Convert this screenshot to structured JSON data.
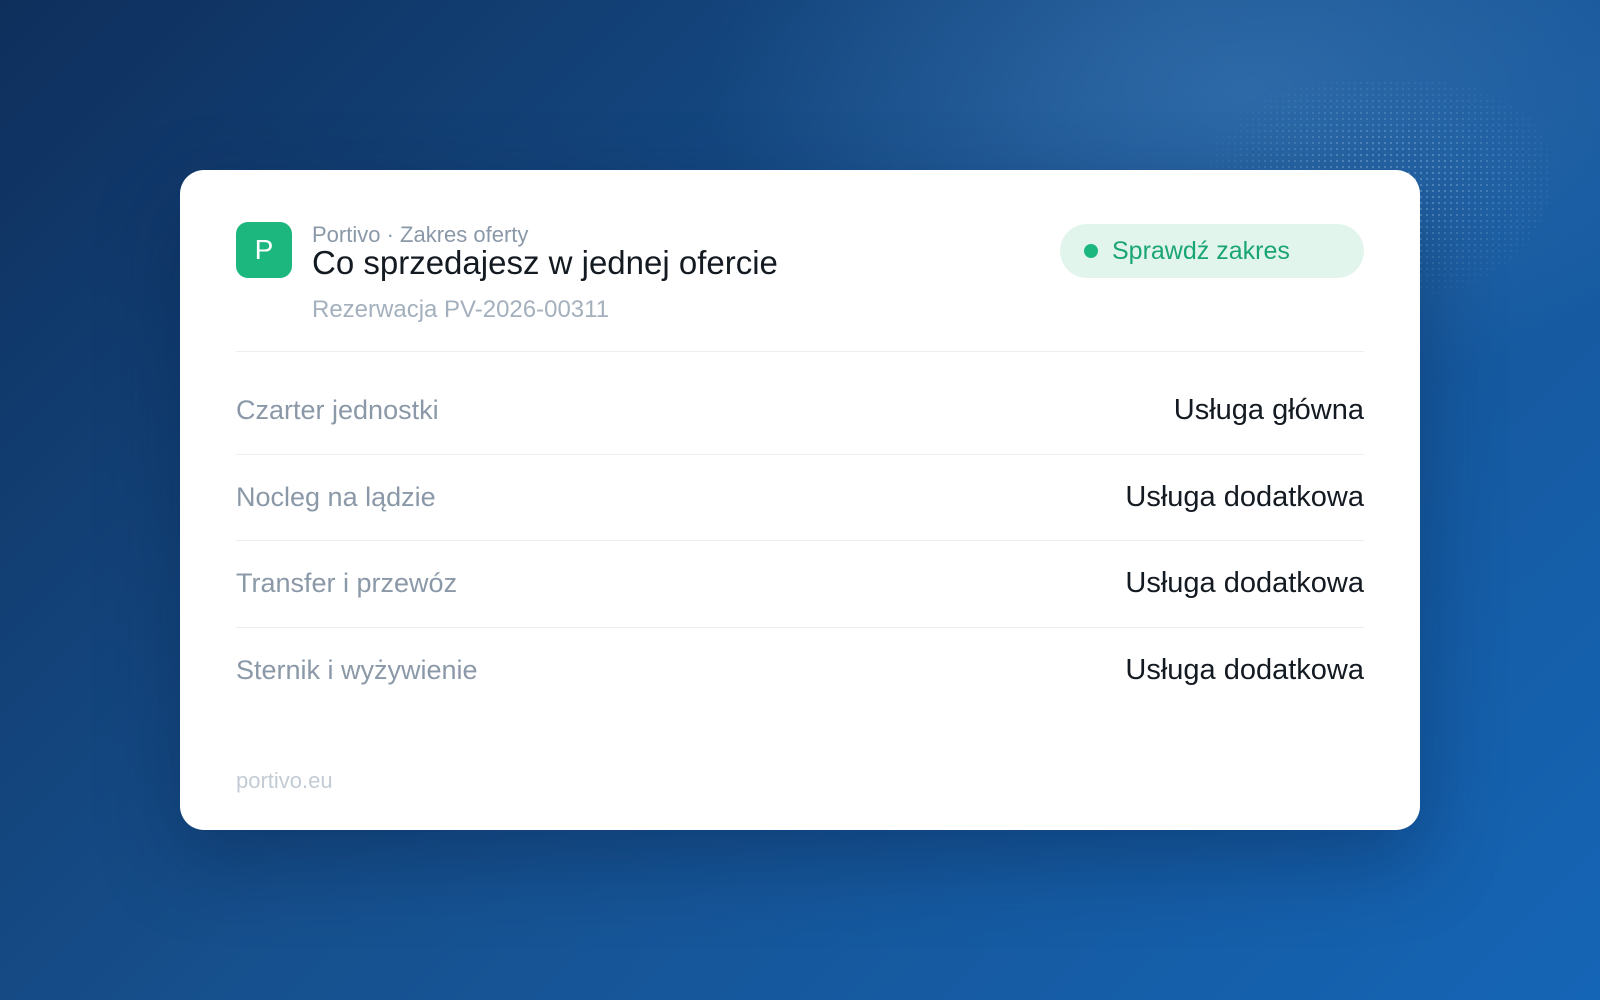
{
  "header": {
    "logo_letter": "P",
    "eyebrow": "Portivo · Zakres oferty",
    "title": "Co sprzedajesz w jednej ofercie",
    "subtitle": "Rezerwacja PV-2026-00311"
  },
  "status": {
    "label": "Sprawdź zakres",
    "color": "#1bb77f"
  },
  "rows": [
    {
      "label": "Czarter jednostki",
      "value": "Usługa główna"
    },
    {
      "label": "Nocleg na lądzie",
      "value": "Usługa dodatkowa"
    },
    {
      "label": "Transfer i przewóz",
      "value": "Usługa dodatkowa"
    },
    {
      "label": "Sternik i wyżywienie",
      "value": "Usługa dodatkowa"
    }
  ],
  "footer": {
    "domain": "portivo.eu"
  },
  "colors": {
    "accent": "#1bb77f",
    "background_start": "#0e2f5c",
    "background_end": "#1565b6"
  }
}
